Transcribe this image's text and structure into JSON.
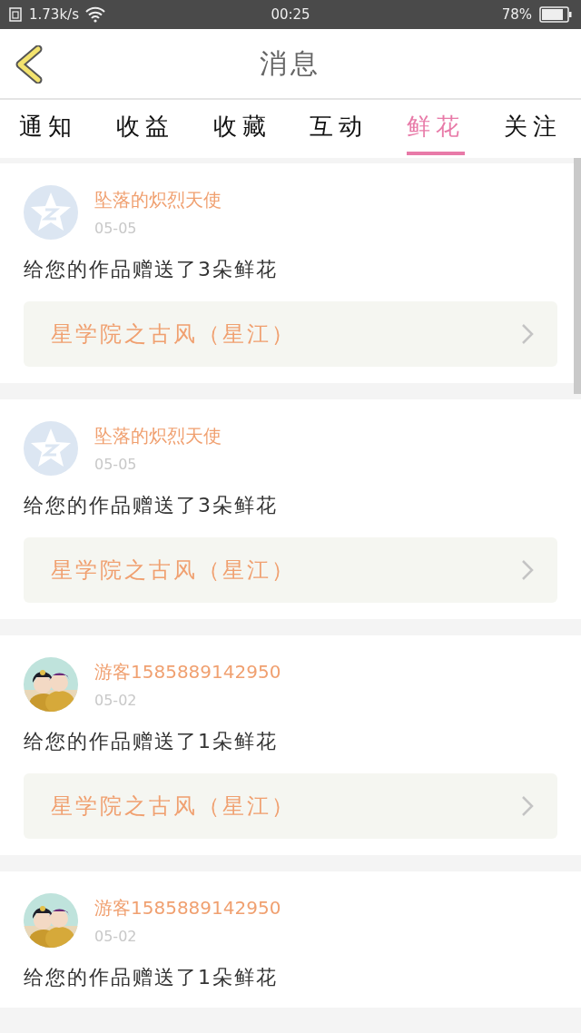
{
  "status_bar": {
    "speed": "1.73k/s",
    "time": "00:25",
    "battery": "78%"
  },
  "header": {
    "title": "消息"
  },
  "tabs": [
    {
      "label": "通知",
      "selected": false
    },
    {
      "label": "收益",
      "selected": false
    },
    {
      "label": "收藏",
      "selected": false
    },
    {
      "label": "互动",
      "selected": false
    },
    {
      "label": "鲜花",
      "selected": true
    },
    {
      "label": "关注",
      "selected": false
    }
  ],
  "messages": [
    {
      "avatar": {
        "kind": "default"
      },
      "name": "坠落的炽烈天使",
      "date": "05-05",
      "text": "给您的作品赠送了3朵鲜花",
      "work": "星学院之古风（星江）"
    },
    {
      "avatar": {
        "kind": "default"
      },
      "name": "坠落的炽烈天使",
      "date": "05-05",
      "text": "给您的作品赠送了3朵鲜花",
      "work": "星学院之古风（星江）"
    },
    {
      "name": "游客1585889142950",
      "date": "05-02",
      "text": "给您的作品赠送了1朵鲜花",
      "work": "星学院之古风（星江）"
    },
    {
      "name": "游客1585889142950",
      "date": "05-02",
      "text": "给您的作品赠送了1朵鲜花"
    }
  ]
}
